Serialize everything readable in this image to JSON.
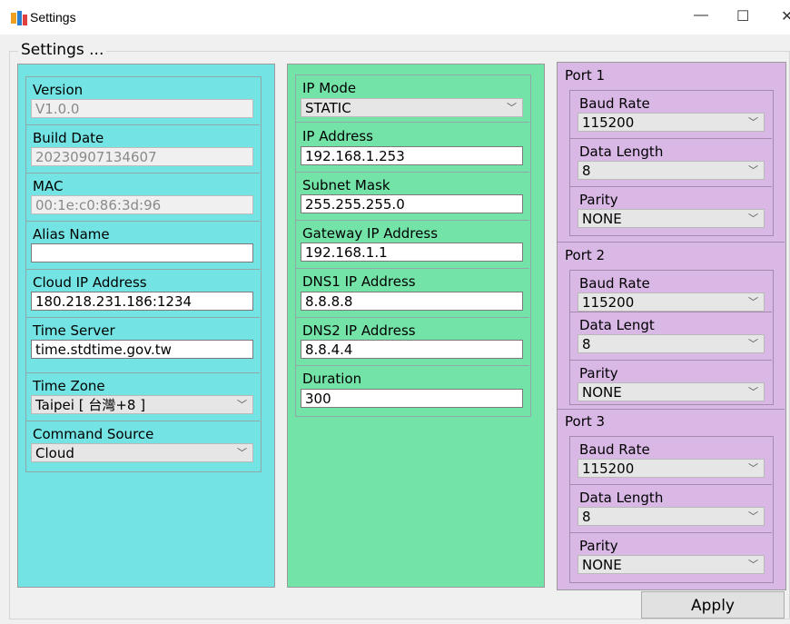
{
  "window": {
    "title": "Settings",
    "minimize_icon": "minimize-icon",
    "maximize_icon": "maximize-icon",
    "close_icon": "close-icon"
  },
  "group_title": "Settings ...",
  "device": {
    "version": {
      "label": "Version",
      "value": "V1.0.0"
    },
    "build_date": {
      "label": "Build Date",
      "value": "20230907134607"
    },
    "mac": {
      "label": "MAC",
      "value": "00:1e:c0:86:3d:96"
    },
    "alias_name": {
      "label": "Alias Name",
      "value": ""
    },
    "cloud_ip": {
      "label": "Cloud IP Address",
      "value": "180.218.231.186:1234"
    },
    "time_server": {
      "label": "Time Server",
      "value": "time.stdtime.gov.tw"
    },
    "time_zone": {
      "label": "Time Zone",
      "value": "Taipei [ 台灣+8 ]"
    },
    "command_source": {
      "label": "Command Source",
      "value": "Cloud"
    }
  },
  "network": {
    "ip_mode": {
      "label": "IP Mode",
      "value": "STATIC"
    },
    "ip_address": {
      "label": "IP Address",
      "value": "192.168.1.253"
    },
    "subnet_mask": {
      "label": "Subnet Mask",
      "value": "255.255.255.0"
    },
    "gateway": {
      "label": "Gateway IP Address",
      "value": "192.168.1.1"
    },
    "dns1": {
      "label": "DNS1 IP Address",
      "value": "8.8.8.8"
    },
    "dns2": {
      "label": "DNS2 IP Address",
      "value": "8.8.4.4"
    },
    "duration": {
      "label": "Duration",
      "value": "300"
    }
  },
  "ports": [
    {
      "title": "Port 1",
      "baud_label": "Baud Rate",
      "baud": "115200",
      "length_label": "Data Length",
      "length": "8",
      "parity_label": "Parity",
      "parity": "NONE"
    },
    {
      "title": "Port 2",
      "baud_label": "Baud Rate",
      "baud": "115200",
      "length_label": "Data Lengt",
      "length": "8",
      "parity_label": "Parity",
      "parity": "NONE"
    },
    {
      "title": "Port 3",
      "baud_label": "Baud Rate",
      "baud": "115200",
      "length_label": "Data Length",
      "length": "8",
      "parity_label": "Parity",
      "parity": "NONE"
    }
  ],
  "apply_label": "Apply",
  "colors": {
    "device_panel": "#73e3e3",
    "network_panel": "#73e3a8",
    "ports_panel": "#d9b8e6"
  }
}
